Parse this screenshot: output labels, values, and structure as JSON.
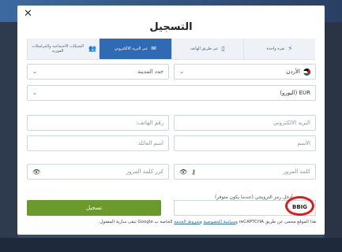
{
  "modal": {
    "title": "التسجيل",
    "close_icon": "close-icon"
  },
  "tabs": [
    {
      "label": "نقرة واحدة",
      "icon": "lightning-icon",
      "active": false
    },
    {
      "label": "عن طريق الهاتف",
      "icon": "phone-icon",
      "active": false
    },
    {
      "label": "عبر البريد الالكتروني",
      "icon": "envelope-icon",
      "active": true
    },
    {
      "label": "الشبكات الاجتماعية والمراسلات الفورية",
      "icon": "users-icon",
      "active": false
    }
  ],
  "form": {
    "country": "الأردن",
    "city_placeholder": "حدد المدينة",
    "currency": "EUR (اليورو)",
    "email_placeholder": "البريد الالكتروني",
    "phone_placeholder": "رقم الهاتف:",
    "first_name_placeholder": "الاسم",
    "last_name_placeholder": "اسم العائلة",
    "password_placeholder": "كلمة المرور",
    "confirm_password_placeholder": "كرر كلمة المرور",
    "promo_label": "أدخل رمز الترويجي (عندما يكون متوفر)",
    "promo_value": "BBIG",
    "register_label": "تسجيل"
  },
  "recaptcha": {
    "text_start": "هذا الموقع محمي عن طريق reCAPTCHA و",
    "privacy_link": "سياسة الخصوصية",
    "and": " و",
    "terms_link": "شروط الخدمة",
    "text_end": " الخاصة ب Google تبقى سارية المفعول."
  },
  "colors": {
    "accent": "#2f6bb5",
    "register": "#6a9a2c",
    "highlight": "#e01b1b"
  }
}
